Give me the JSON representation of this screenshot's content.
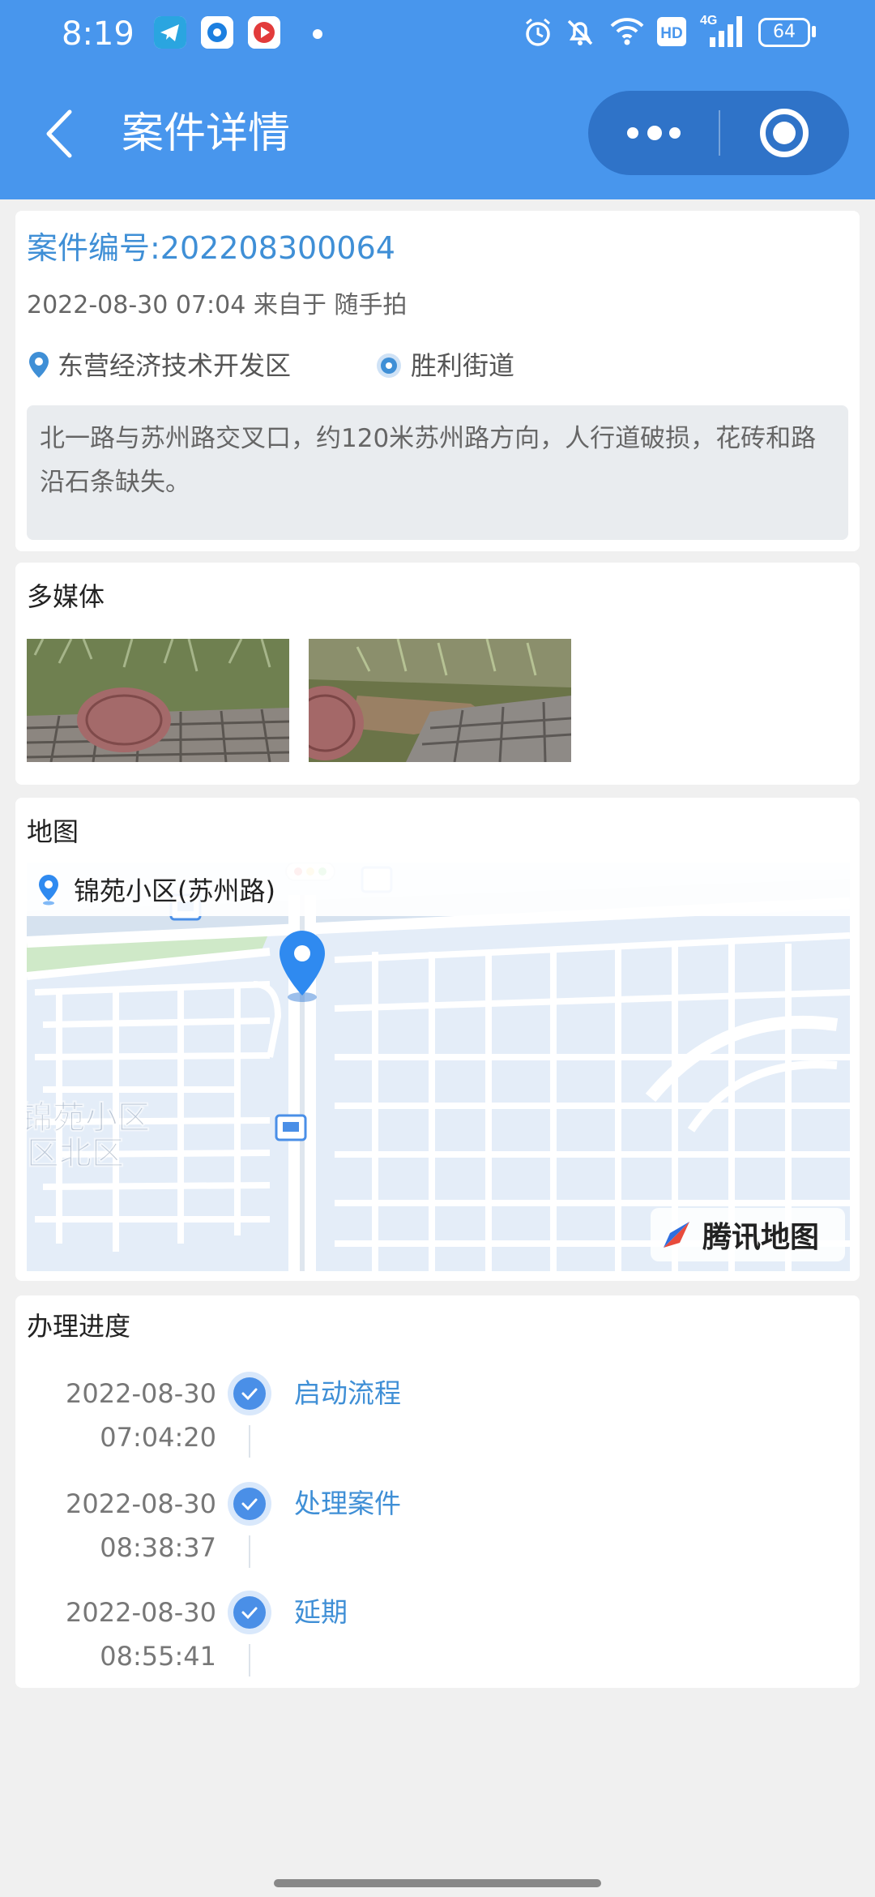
{
  "status_bar": {
    "time": "8:19",
    "network": "4G",
    "battery": "64",
    "icons": [
      "telegram-icon",
      "circle-app-icon",
      "video-app-icon",
      "alarm-icon",
      "mute-icon",
      "wifi-icon",
      "hd-icon",
      "signal-icon"
    ]
  },
  "nav": {
    "title": "案件详情",
    "accent": "#4896ed"
  },
  "case": {
    "number": "案件编号:202208300064",
    "meta": "2022-08-30 07:04 来自于 随手拍",
    "district": "东营经济技术开发区",
    "street": "胜利街道",
    "description": "北一路与苏州路交叉口，约120米苏州路方向，人行道破损，花砖和路沿石条缺失。"
  },
  "media": {
    "title": "多媒体",
    "photo_count": 2
  },
  "map": {
    "title": "地图",
    "location_label": "锦苑小区(苏州路)",
    "area_labels": [
      "锦苑小区",
      "区北区"
    ],
    "provider": "腾讯地图"
  },
  "progress": {
    "title": "办理进度",
    "steps": [
      {
        "date": "2022-08-30",
        "time": "07:04:20",
        "name": "启动流程"
      },
      {
        "date": "2022-08-30",
        "time": "08:38:37",
        "name": "处理案件"
      },
      {
        "date": "2022-08-30",
        "time": "08:55:41",
        "name": "延期"
      }
    ]
  }
}
